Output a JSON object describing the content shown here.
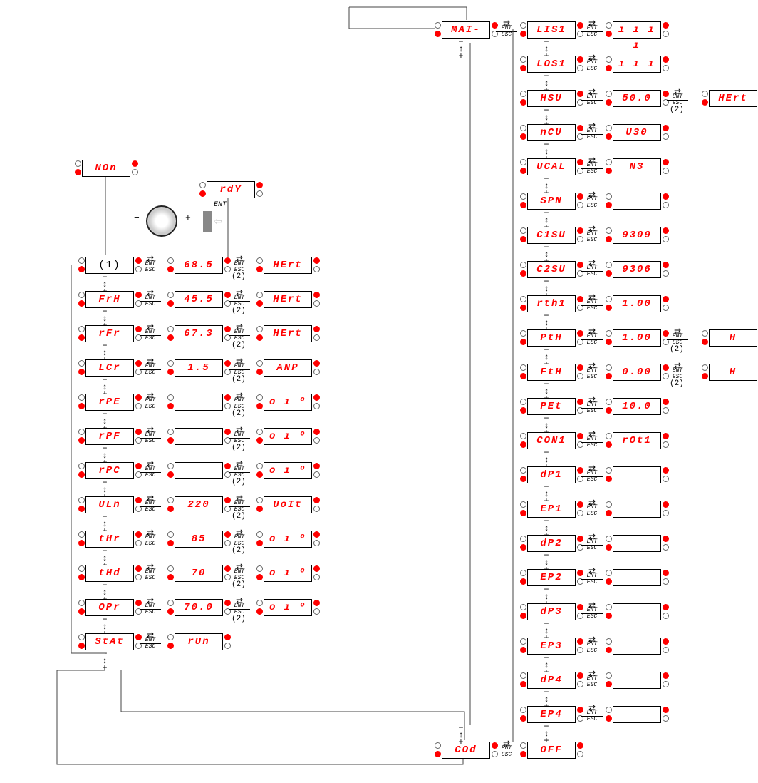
{
  "top": {
    "mai": "MAI-",
    "lis1": "LIS1",
    "lis1_val": "ı ı ı ı",
    "non": "NOn",
    "rdy": "rdY"
  },
  "labels": {
    "ent": "ENT",
    "esc": "ESC",
    "note2": "(2)",
    "note1": "(1)"
  },
  "left": [
    {
      "code": "(1)",
      "val": "68.5",
      "unit": "HErt"
    },
    {
      "code": "FrH",
      "val": "45.5",
      "unit": "HErt"
    },
    {
      "code": "rFr",
      "val": "67.3",
      "unit": "HErt"
    },
    {
      "code": "LCr",
      "val": "1.5",
      "unit": "ANP"
    },
    {
      "code": "rPE",
      "val": "",
      "unit": "o ı º"
    },
    {
      "code": "rPF",
      "val": "",
      "unit": "o ı º"
    },
    {
      "code": "rPC",
      "val": "",
      "unit": "o ı º"
    },
    {
      "code": "ULn",
      "val": "220",
      "unit": "UoIt"
    },
    {
      "code": "tHr",
      "val": "85",
      "unit": "o ı º"
    },
    {
      "code": "tHd",
      "val": "70",
      "unit": "o ı º"
    },
    {
      "code": "OPr",
      "val": "70.0",
      "unit": "o ı º"
    },
    {
      "code": "StAt",
      "val": "rUn",
      "unit": null
    }
  ],
  "right": [
    {
      "code": "LOS1",
      "val": "ı ı ı"
    },
    {
      "code": "HSU",
      "val": "50.0",
      "extra": "HErt"
    },
    {
      "code": "nCU",
      "val": "U30"
    },
    {
      "code": "UCAL",
      "val": "N3"
    },
    {
      "code": "SPN",
      "val": ""
    },
    {
      "code": "C1SU",
      "val": "9309"
    },
    {
      "code": "C2SU",
      "val": "9306"
    },
    {
      "code": "rth1",
      "val": "1.00"
    },
    {
      "code": "PtH",
      "val": "1.00",
      "extra": "H"
    },
    {
      "code": "FtH",
      "val": "0.00",
      "extra": "H"
    },
    {
      "code": "PEt",
      "val": "10.0"
    },
    {
      "code": "CON1",
      "val": "rOt1"
    },
    {
      "code": "dP1",
      "val": ""
    },
    {
      "code": "EP1",
      "val": ""
    },
    {
      "code": "dP2",
      "val": ""
    },
    {
      "code": "EP2",
      "val": ""
    },
    {
      "code": "dP3",
      "val": ""
    },
    {
      "code": "EP3",
      "val": ""
    },
    {
      "code": "dP4",
      "val": ""
    },
    {
      "code": "EP4",
      "val": ""
    }
  ],
  "bottom": {
    "cod": "COd",
    "off": "OFF"
  }
}
